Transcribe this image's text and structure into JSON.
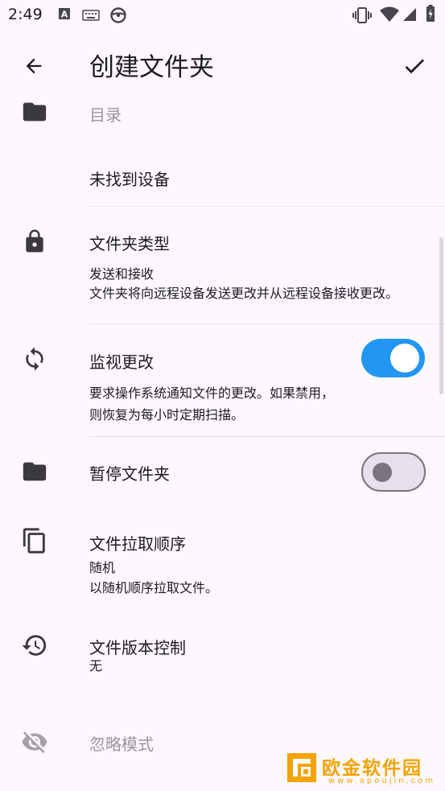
{
  "status_bar": {
    "time": "2:49",
    "left_icons": [
      "a-keyboard-icon",
      "keyboard-icon",
      "steering-wheel-icon"
    ],
    "right_icons": [
      "vibrate-icon",
      "wifi-icon",
      "signal-icon",
      "battery-charging-icon"
    ]
  },
  "app_bar": {
    "back_icon": "arrow-back-icon",
    "title": "创建文件夹",
    "confirm_icon": "check-icon"
  },
  "settings": {
    "directory": {
      "icon": "folder-icon",
      "label": "目录"
    },
    "device": {
      "label": "未找到设备"
    },
    "folder_type": {
      "icon": "lock-icon",
      "title": "文件夹类型",
      "value": "发送和接收",
      "description": "文件夹将向远程设备发送更改并从远程设备接收更改。"
    },
    "watch_changes": {
      "icon": "sync-icon",
      "title": "监视更改",
      "description_line1": "要求操作系统通知文件的更改。如果禁用，",
      "description_line2": "则恢复为每小时定期扫描。",
      "enabled": true
    },
    "pause_folder": {
      "icon": "folder-icon",
      "title": "暂停文件夹",
      "enabled": false
    },
    "pull_order": {
      "icon": "copy-icon",
      "title": "文件拉取顺序",
      "value": "随机",
      "description": "以随机顺序拉取文件。"
    },
    "versioning": {
      "icon": "history-icon",
      "title": "文件版本控制",
      "value": "无"
    },
    "ignore_patterns": {
      "icon": "visibility-off-icon",
      "title": "忽略模式"
    }
  },
  "watermark": {
    "text": "欧金软件园",
    "url": "www.apoujin.com"
  },
  "colors": {
    "background": "#fdf8fd",
    "accent": "#2196f3",
    "watermark": "#f5a300"
  }
}
